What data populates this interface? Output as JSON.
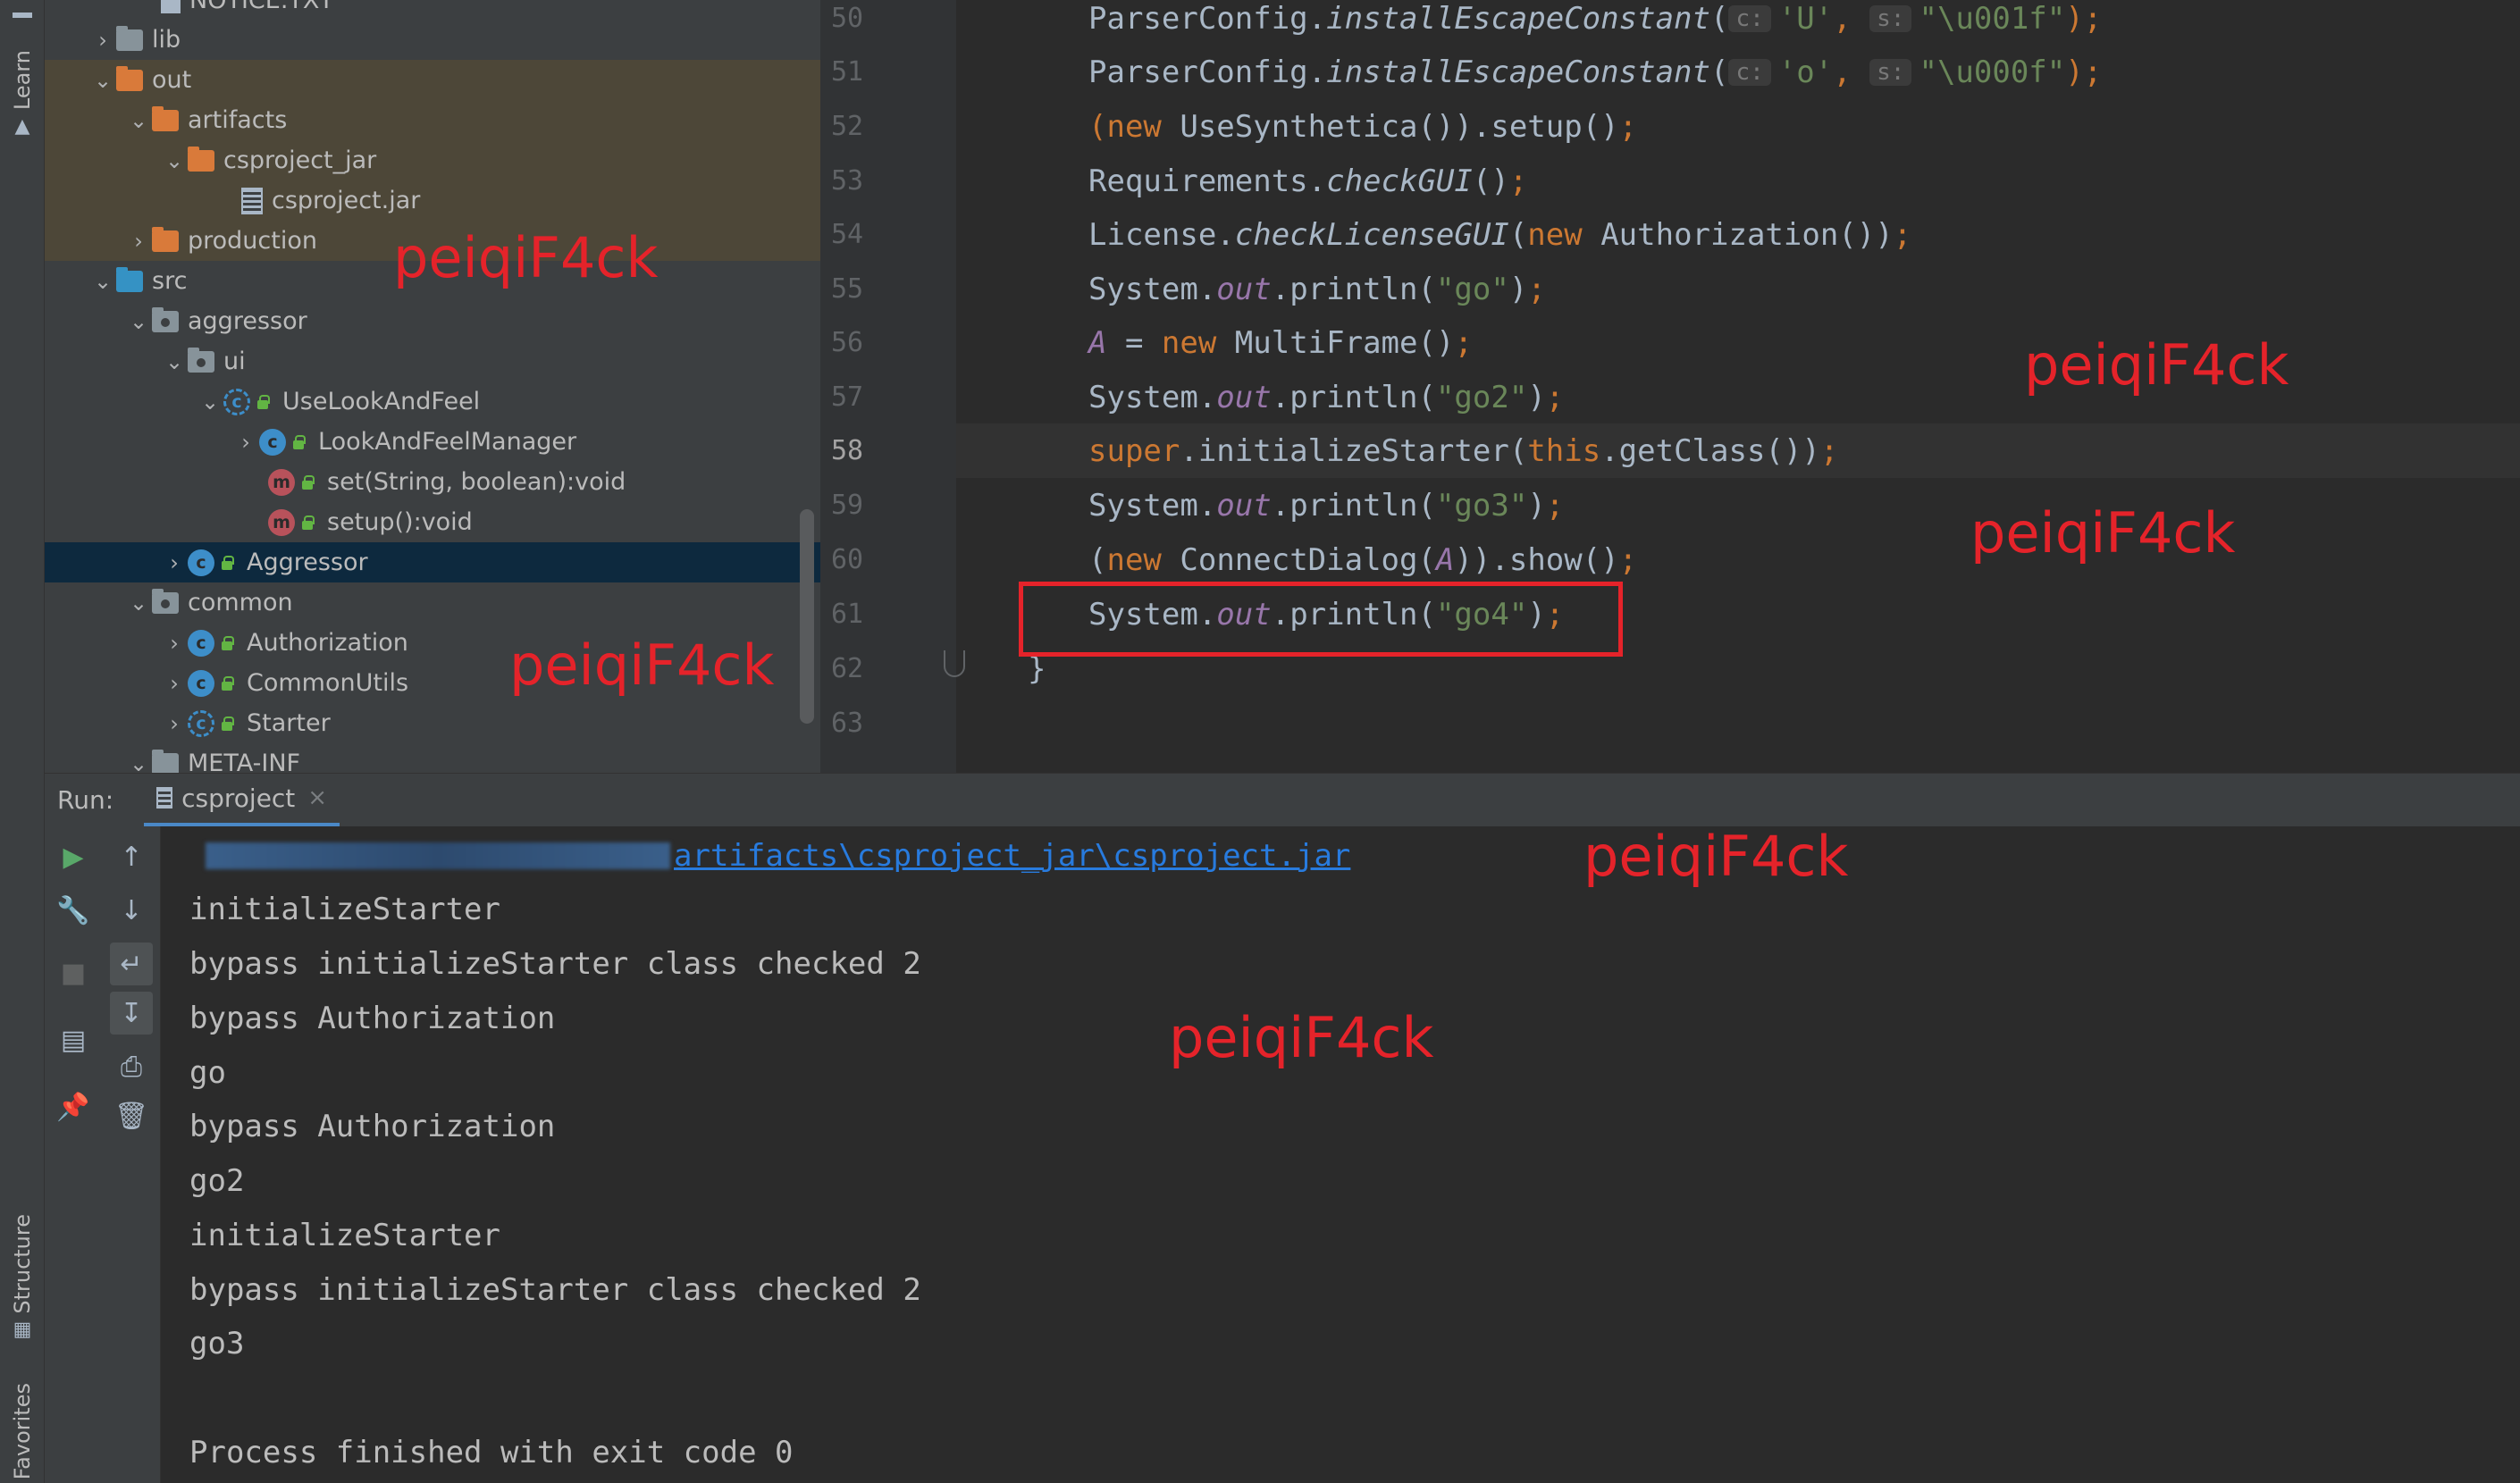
{
  "left_strip": {
    "learn_label": "Learn",
    "structure_label": "Structure",
    "favorites_label": "Favorites"
  },
  "project_tree": {
    "items": [
      {
        "label": "NOTICE.TXT"
      },
      {
        "label": "lib"
      },
      {
        "label": "out"
      },
      {
        "label": "artifacts"
      },
      {
        "label": "csproject_jar"
      },
      {
        "label": "csproject.jar"
      },
      {
        "label": "production"
      },
      {
        "label": "src"
      },
      {
        "label": "aggressor"
      },
      {
        "label": "ui"
      },
      {
        "label": "UseLookAndFeel"
      },
      {
        "label": "LookAndFeelManager"
      },
      {
        "label": "set(String, boolean):void"
      },
      {
        "label": "setup():void"
      },
      {
        "label": "Aggressor"
      },
      {
        "label": "common"
      },
      {
        "label": "Authorization"
      },
      {
        "label": "CommonUtils"
      },
      {
        "label": "Starter"
      },
      {
        "label": "META-INF"
      }
    ]
  },
  "editor": {
    "current_line": "58",
    "lines": [
      {
        "num": "50",
        "p1": "ParserConfig.",
        "p2": "installEscapeConstant",
        "p3": "(",
        "h1": "c:",
        "s1": "'U'",
        "p4": ", ",
        "h2": "s:",
        "s2": "\"\\u001f\"",
        "p5": ");"
      },
      {
        "num": "51",
        "p1": "ParserConfig.",
        "p2": "installEscapeConstant",
        "p3": "(",
        "h1": "c:",
        "s1": "'o'",
        "p4": ", ",
        "h2": "s:",
        "s2": "\"\\u000f\"",
        "p5": ");"
      },
      {
        "num": "52",
        "k1": "(new ",
        "p1": "UseSynthetica()).setup()",
        "k2": ";"
      },
      {
        "num": "53",
        "p1": "Requirements.",
        "p2": "checkGUI",
        "p3": "()",
        "k1": ";"
      },
      {
        "num": "54",
        "p1": "License.",
        "p2": "checkLicenseGUI",
        "p3": "(",
        "k1": "new ",
        "p4": "Authorization())",
        "k2": ";"
      },
      {
        "num": "55",
        "p1": "System.",
        "f1": "out",
        "p2": ".println(",
        "s1": "\"go\"",
        "p3": ")",
        "k1": ";"
      },
      {
        "num": "56",
        "f1": "A",
        "p1": " = ",
        "k1": "new ",
        "p2": "MultiFrame()",
        "k2": ";"
      },
      {
        "num": "57",
        "p1": "System.",
        "f1": "out",
        "p2": ".println(",
        "s1": "\"go2\"",
        "p3": ")",
        "k1": ";"
      },
      {
        "num": "58",
        "k1": "super",
        "p1": ".initializeStarter(",
        "k2": "this",
        "p2": ".getClass())",
        "k3": ";"
      },
      {
        "num": "59",
        "p1": "System.",
        "f1": "out",
        "p2": ".println(",
        "s1": "\"go3\"",
        "p3": ")",
        "k1": ";"
      },
      {
        "num": "60",
        "p1": "(",
        "k1": "new ",
        "p2": "ConnectDialog(",
        "f1": "A",
        "p3": ")).show()",
        "k2": ";"
      },
      {
        "num": "61",
        "p1": "System.",
        "f1": "out",
        "p2": ".println(",
        "s1": "\"go4\"",
        "p3": ")",
        "k1": ";"
      },
      {
        "num": "62",
        "p1": "}"
      },
      {
        "num": "63",
        "p1": ""
      }
    ]
  },
  "run_panel": {
    "label": "Run:",
    "tab_label": "csproject",
    "console_path": "artifacts\\csproject_jar\\csproject.jar",
    "console_lines": [
      "initializeStarter",
      "bypass initializeStarter class checked 2",
      "bypass Authorization",
      "go",
      "bypass Authorization",
      "go2",
      "initializeStarter",
      "bypass initializeStarter class checked 2",
      "go3",
      "",
      "Process finished with exit code 0"
    ]
  },
  "watermarks": [
    "peiqiF4ck",
    "peiqiF4ck",
    "peiqiF4ck",
    "peiqiF4ck",
    "peiqiF4ck",
    "peiqiF4ck"
  ],
  "colors": {
    "keyword": "#cc7832",
    "string": "#6a8759",
    "field": "#9876aa",
    "selection": "#0d293e",
    "highlight_box": "#e5232a",
    "watermark": "#e5232a"
  }
}
